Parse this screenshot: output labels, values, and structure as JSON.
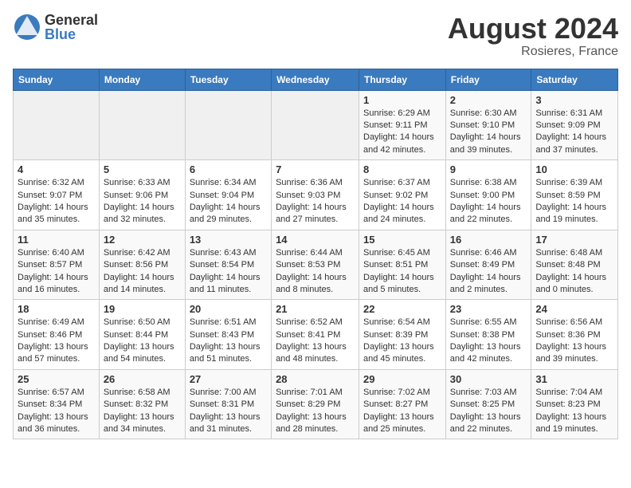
{
  "header": {
    "logo_general": "General",
    "logo_blue": "Blue",
    "month_year": "August 2024",
    "location": "Rosieres, France"
  },
  "weekdays": [
    "Sunday",
    "Monday",
    "Tuesday",
    "Wednesday",
    "Thursday",
    "Friday",
    "Saturday"
  ],
  "weeks": [
    [
      {
        "day": "",
        "info": ""
      },
      {
        "day": "",
        "info": ""
      },
      {
        "day": "",
        "info": ""
      },
      {
        "day": "",
        "info": ""
      },
      {
        "day": "1",
        "info": "Sunrise: 6:29 AM\nSunset: 9:11 PM\nDaylight: 14 hours and 42 minutes."
      },
      {
        "day": "2",
        "info": "Sunrise: 6:30 AM\nSunset: 9:10 PM\nDaylight: 14 hours and 39 minutes."
      },
      {
        "day": "3",
        "info": "Sunrise: 6:31 AM\nSunset: 9:09 PM\nDaylight: 14 hours and 37 minutes."
      }
    ],
    [
      {
        "day": "4",
        "info": "Sunrise: 6:32 AM\nSunset: 9:07 PM\nDaylight: 14 hours and 35 minutes."
      },
      {
        "day": "5",
        "info": "Sunrise: 6:33 AM\nSunset: 9:06 PM\nDaylight: 14 hours and 32 minutes."
      },
      {
        "day": "6",
        "info": "Sunrise: 6:34 AM\nSunset: 9:04 PM\nDaylight: 14 hours and 29 minutes."
      },
      {
        "day": "7",
        "info": "Sunrise: 6:36 AM\nSunset: 9:03 PM\nDaylight: 14 hours and 27 minutes."
      },
      {
        "day": "8",
        "info": "Sunrise: 6:37 AM\nSunset: 9:02 PM\nDaylight: 14 hours and 24 minutes."
      },
      {
        "day": "9",
        "info": "Sunrise: 6:38 AM\nSunset: 9:00 PM\nDaylight: 14 hours and 22 minutes."
      },
      {
        "day": "10",
        "info": "Sunrise: 6:39 AM\nSunset: 8:59 PM\nDaylight: 14 hours and 19 minutes."
      }
    ],
    [
      {
        "day": "11",
        "info": "Sunrise: 6:40 AM\nSunset: 8:57 PM\nDaylight: 14 hours and 16 minutes."
      },
      {
        "day": "12",
        "info": "Sunrise: 6:42 AM\nSunset: 8:56 PM\nDaylight: 14 hours and 14 minutes."
      },
      {
        "day": "13",
        "info": "Sunrise: 6:43 AM\nSunset: 8:54 PM\nDaylight: 14 hours and 11 minutes."
      },
      {
        "day": "14",
        "info": "Sunrise: 6:44 AM\nSunset: 8:53 PM\nDaylight: 14 hours and 8 minutes."
      },
      {
        "day": "15",
        "info": "Sunrise: 6:45 AM\nSunset: 8:51 PM\nDaylight: 14 hours and 5 minutes."
      },
      {
        "day": "16",
        "info": "Sunrise: 6:46 AM\nSunset: 8:49 PM\nDaylight: 14 hours and 2 minutes."
      },
      {
        "day": "17",
        "info": "Sunrise: 6:48 AM\nSunset: 8:48 PM\nDaylight: 14 hours and 0 minutes."
      }
    ],
    [
      {
        "day": "18",
        "info": "Sunrise: 6:49 AM\nSunset: 8:46 PM\nDaylight: 13 hours and 57 minutes."
      },
      {
        "day": "19",
        "info": "Sunrise: 6:50 AM\nSunset: 8:44 PM\nDaylight: 13 hours and 54 minutes."
      },
      {
        "day": "20",
        "info": "Sunrise: 6:51 AM\nSunset: 8:43 PM\nDaylight: 13 hours and 51 minutes."
      },
      {
        "day": "21",
        "info": "Sunrise: 6:52 AM\nSunset: 8:41 PM\nDaylight: 13 hours and 48 minutes."
      },
      {
        "day": "22",
        "info": "Sunrise: 6:54 AM\nSunset: 8:39 PM\nDaylight: 13 hours and 45 minutes."
      },
      {
        "day": "23",
        "info": "Sunrise: 6:55 AM\nSunset: 8:38 PM\nDaylight: 13 hours and 42 minutes."
      },
      {
        "day": "24",
        "info": "Sunrise: 6:56 AM\nSunset: 8:36 PM\nDaylight: 13 hours and 39 minutes."
      }
    ],
    [
      {
        "day": "25",
        "info": "Sunrise: 6:57 AM\nSunset: 8:34 PM\nDaylight: 13 hours and 36 minutes."
      },
      {
        "day": "26",
        "info": "Sunrise: 6:58 AM\nSunset: 8:32 PM\nDaylight: 13 hours and 34 minutes."
      },
      {
        "day": "27",
        "info": "Sunrise: 7:00 AM\nSunset: 8:31 PM\nDaylight: 13 hours and 31 minutes."
      },
      {
        "day": "28",
        "info": "Sunrise: 7:01 AM\nSunset: 8:29 PM\nDaylight: 13 hours and 28 minutes."
      },
      {
        "day": "29",
        "info": "Sunrise: 7:02 AM\nSunset: 8:27 PM\nDaylight: 13 hours and 25 minutes."
      },
      {
        "day": "30",
        "info": "Sunrise: 7:03 AM\nSunset: 8:25 PM\nDaylight: 13 hours and 22 minutes."
      },
      {
        "day": "31",
        "info": "Sunrise: 7:04 AM\nSunset: 8:23 PM\nDaylight: 13 hours and 19 minutes."
      }
    ]
  ]
}
